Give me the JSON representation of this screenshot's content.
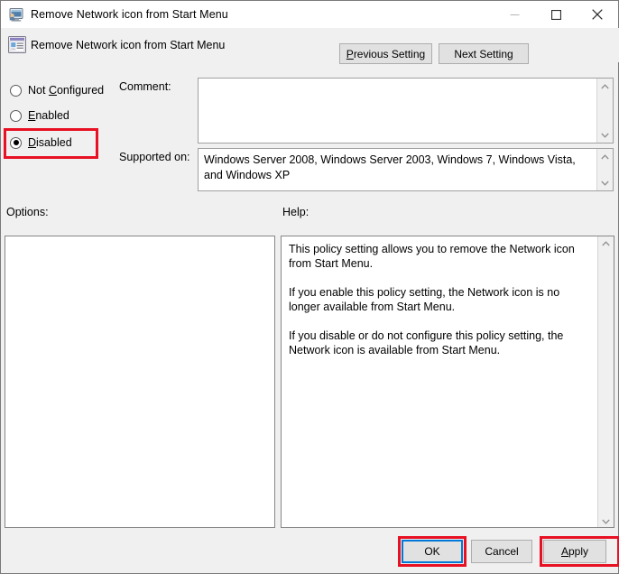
{
  "window": {
    "title": "Remove Network icon from Start Menu",
    "title_icon": "computer-user-icon",
    "controls": {
      "minimize": "minimize-icon",
      "maximize": "maximize-icon",
      "close": "close-icon"
    }
  },
  "header": {
    "icon": "policy-setting-icon",
    "title": "Remove Network icon from Start Menu",
    "prev_setting": "Previous Setting",
    "prev_setting_accel": "P",
    "prev_setting_rest": "revious Setting",
    "next_setting": "Next Setting"
  },
  "state": {
    "options": [
      {
        "label": "Not Configured",
        "accel": "C",
        "before": "Not ",
        "after": "onfigured",
        "selected": false
      },
      {
        "label": "Enabled",
        "accel": "E",
        "before": "",
        "after": "nabled",
        "selected": false
      },
      {
        "label": "Disabled",
        "accel": "D",
        "before": "",
        "after": "isabled",
        "selected": true
      }
    ],
    "selected_value": "Disabled"
  },
  "comment": {
    "label": "Comment:",
    "value": "",
    "placeholder": ""
  },
  "supported_on": {
    "label": "Supported on:",
    "value": "Windows Server 2008, Windows Server 2003, Windows 7, Windows Vista, and Windows XP"
  },
  "options_panel": {
    "label": "Options:",
    "content": ""
  },
  "help_panel": {
    "label": "Help:",
    "paragraphs": [
      "This policy setting allows you to remove the Network icon from Start Menu.",
      "If you enable this policy setting, the Network icon is no longer available from Start Menu.",
      "If you disable or do not configure this policy setting, the Network icon is available from Start Menu."
    ]
  },
  "footer": {
    "ok": "OK",
    "cancel": "Cancel",
    "apply": "Apply",
    "apply_accel": "A",
    "apply_rest": "pply"
  },
  "annotations": {
    "color": "#e81123",
    "targets": [
      "disabled-radio",
      "ok-button",
      "apply-button"
    ]
  },
  "icons": {
    "scroll_up": "chevron-up-icon",
    "scroll_down": "chevron-down-icon"
  }
}
